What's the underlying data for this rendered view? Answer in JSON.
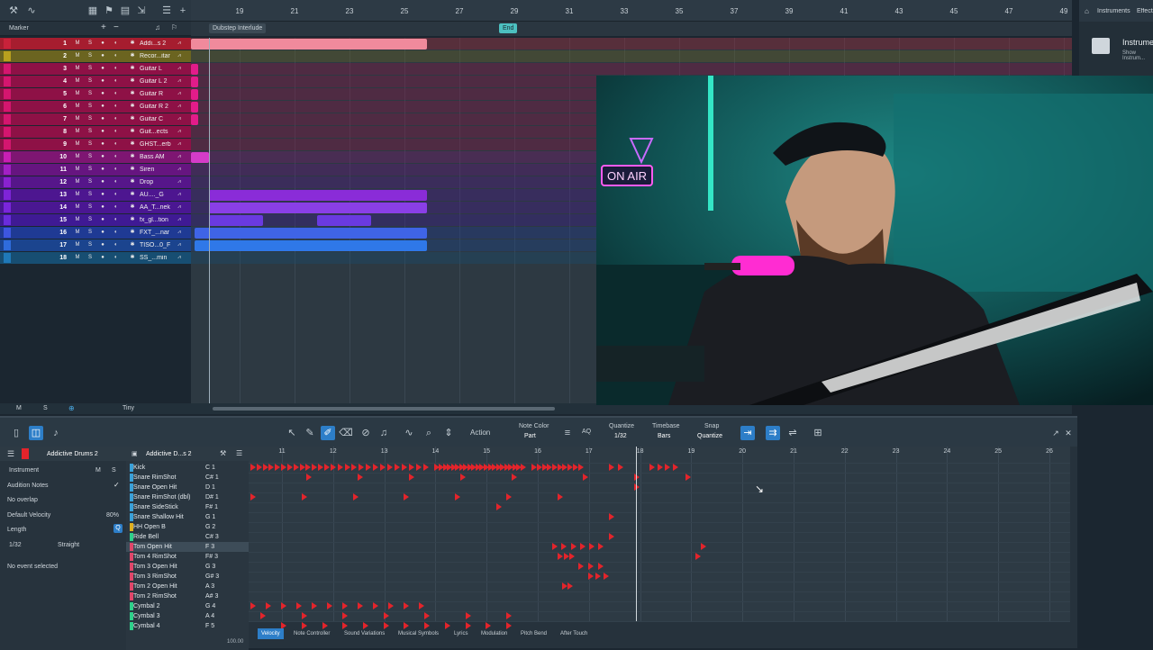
{
  "arrange": {
    "marker_label": "Marker",
    "bars": [
      "19",
      "21",
      "23",
      "25",
      "27",
      "29",
      "31",
      "33",
      "35",
      "37",
      "39",
      "41",
      "43",
      "45",
      "47",
      "49"
    ],
    "markers": [
      {
        "label": "Dubstep Interlude"
      },
      {
        "label": "End"
      }
    ],
    "tracks": [
      {
        "num": "1",
        "name": "Addi...s 2",
        "color": "#c8223a",
        "bg": "#a61d2f"
      },
      {
        "num": "2",
        "name": "Recor...itar",
        "color": "#b8a01e",
        "bg": "#6b6420"
      },
      {
        "num": "3",
        "name": "Guitar L",
        "color": "#d4166f",
        "bg": "#8e1146"
      },
      {
        "num": "4",
        "name": "Guitar L 2",
        "color": "#d4166f",
        "bg": "#8e1146"
      },
      {
        "num": "5",
        "name": "Guitar R",
        "color": "#d4166f",
        "bg": "#8e1146"
      },
      {
        "num": "6",
        "name": "Guitar R 2",
        "color": "#d4166f",
        "bg": "#8e1146"
      },
      {
        "num": "7",
        "name": "Guitar C",
        "color": "#d4166f",
        "bg": "#8e1146"
      },
      {
        "num": "8",
        "name": "Guit...ects",
        "color": "#d4166f",
        "bg": "#8e1146"
      },
      {
        "num": "9",
        "name": "GHST...erb",
        "color": "#d4166f",
        "bg": "#8e1146"
      },
      {
        "num": "10",
        "name": "Bass AM",
        "color": "#c81fb4",
        "bg": "#7e1672"
      },
      {
        "num": "11",
        "name": "Siren",
        "color": "#a220c4",
        "bg": "#661580"
      },
      {
        "num": "12",
        "name": "Drop",
        "color": "#8a22d0",
        "bg": "#56168a"
      },
      {
        "num": "13",
        "name": "AU...._G",
        "color": "#7e24d8",
        "bg": "#4d1690"
      },
      {
        "num": "14",
        "name": "AA_T...nek",
        "color": "#7a26da",
        "bg": "#4a1792"
      },
      {
        "num": "15",
        "name": "fx_gl...tion",
        "color": "#6a2cdc",
        "bg": "#3f1a94"
      },
      {
        "num": "16",
        "name": "FXT_...nar",
        "color": "#3d56e0",
        "bg": "#1f3a94"
      },
      {
        "num": "17",
        "name": "TISO...0_F",
        "color": "#2f6cdc",
        "bg": "#1b448e"
      },
      {
        "num": "18",
        "name": "SS_...min",
        "color": "#1f79b8",
        "bg": "#174e72"
      }
    ],
    "bottom": {
      "m": "M",
      "s": "S",
      "zoom": "Tiny"
    }
  },
  "instruments_panel": {
    "tabs": [
      "Instruments",
      "Effects"
    ],
    "item_title": "Instrume...",
    "item_sub": "Show Instrum..."
  },
  "editor": {
    "instrument_label": "Addictive Drums 2",
    "instrument_label_2": "Addictive D...s 2",
    "inspector": {
      "instrument": "Instrument",
      "audition_notes": "Audition Notes",
      "no_overlap": "No overlap",
      "default_velocity": "Default Velocity",
      "velocity_value": "80%",
      "length": "Length",
      "length_value": "1/32",
      "straight": "Straight",
      "no_event": "No event selected"
    },
    "toolbar": {
      "action": "Action",
      "note_color_label": "Note Color",
      "note_color_value": "Part",
      "quantize_label": "Quantize",
      "quantize_value": "1/32",
      "timebase_label": "Timebase",
      "timebase_value": "Bars",
      "snap_label": "Snap",
      "snap_value": "Quantize",
      "aq": "AQ"
    },
    "bars": [
      "11",
      "12",
      "13",
      "14",
      "15",
      "16",
      "17",
      "18",
      "19",
      "20",
      "21",
      "22",
      "23",
      "24",
      "25",
      "26"
    ],
    "drums": [
      {
        "name": "Kick",
        "note": "C 1",
        "color": "#3aa0d8"
      },
      {
        "name": "Snare RimShot",
        "note": "C# 1",
        "color": "#3aa0d8"
      },
      {
        "name": "Snare Open Hit",
        "note": "D 1",
        "color": "#3aa0d8"
      },
      {
        "name": "Snare RimShot (dbl)",
        "note": "D# 1",
        "color": "#3aa0d8"
      },
      {
        "name": "Snare SideStick",
        "note": "F# 1",
        "color": "#3aa0d8"
      },
      {
        "name": "Snare Shallow Hit",
        "note": "G 1",
        "color": "#3aa0d8"
      },
      {
        "name": "HH Open B",
        "note": "G 2",
        "color": "#e0b020"
      },
      {
        "name": "Ride Bell",
        "note": "C# 3",
        "color": "#2ed08a"
      },
      {
        "name": "Tom Open Hit",
        "note": "F 3",
        "color": "#e0476a"
      },
      {
        "name": "Tom 4 RimShot",
        "note": "F# 3",
        "color": "#e0476a"
      },
      {
        "name": "Tom 3 Open Hit",
        "note": "G 3",
        "color": "#e0476a"
      },
      {
        "name": "Tom 3 RimShot",
        "note": "G# 3",
        "color": "#e0476a"
      },
      {
        "name": "Tom 2 Open Hit",
        "note": "A 3",
        "color": "#e0476a"
      },
      {
        "name": "Tom 2 RimShot",
        "note": "A# 3",
        "color": "#e0476a"
      },
      {
        "name": "Cymbal 2",
        "note": "G 4",
        "color": "#2ed08a"
      },
      {
        "name": "Cymbal 3",
        "note": "A 4",
        "color": "#2ed08a"
      },
      {
        "name": "Cymbal 4",
        "note": "F 5",
        "color": "#2ed08a"
      }
    ],
    "tabs": [
      "Velocity",
      "Note Controller",
      "Sound Variations",
      "Musical Symbols",
      "Lyrics",
      "Modulation",
      "Pitch Bend",
      "After Touch"
    ],
    "velocity_scale": "100.00"
  }
}
